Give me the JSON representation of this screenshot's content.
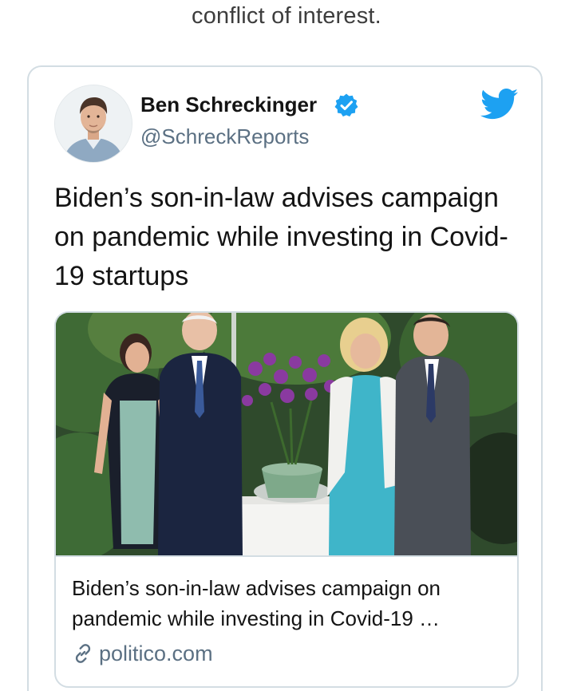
{
  "lead": {
    "text": "conflict of interest."
  },
  "tweet": {
    "author_name": "Ben Schreckinger",
    "author_handle": "@SchreckReports",
    "text": "Biden’s son-in-law advises campaign on pandemic while investing in Covid-19 startups",
    "link_card": {
      "title": "Biden’s son-in-law advises campaign on pandemic while investing in Covid-19 …",
      "domain": "politico.com"
    }
  },
  "icons": {
    "verified": "verified-badge-icon",
    "brand": "twitter-bird-icon",
    "link": "link-icon"
  },
  "colors": {
    "twitter_blue": "#1da1f2",
    "secondary_text": "#5b7083",
    "border": "#d3dde3"
  }
}
